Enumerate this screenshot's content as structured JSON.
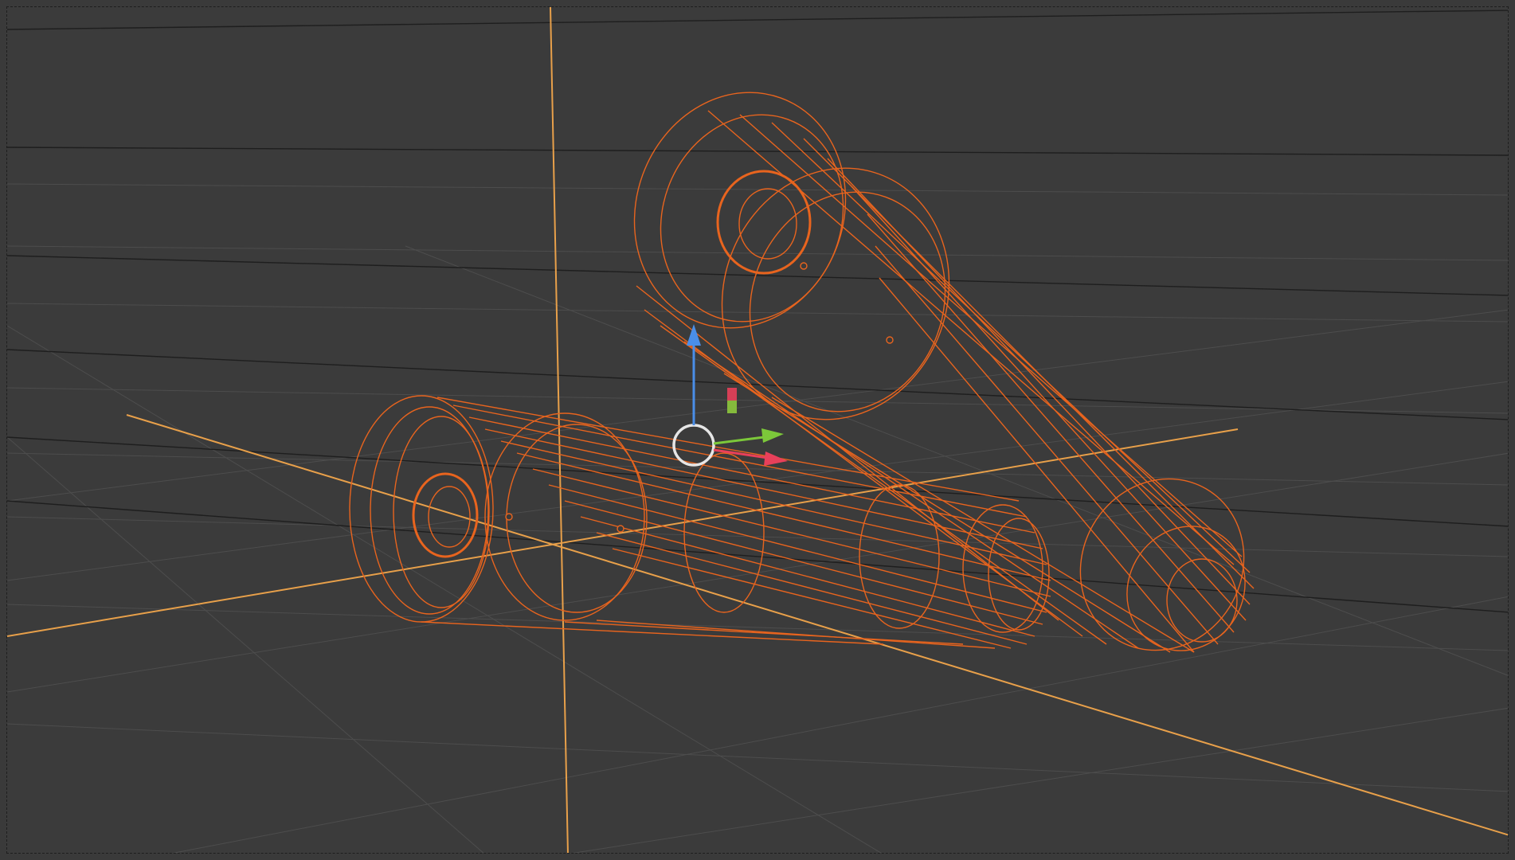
{
  "app": {
    "mode": "wireframe-3d-viewport"
  },
  "colors": {
    "background": "#3b3b3b",
    "grid_line": "#555555",
    "grid_major": "#1e1e1e",
    "axis_orange": "#e8a04a",
    "selection_orange": "#e8641e",
    "gizmo_z": "#4a8ee8",
    "gizmo_y": "#7cc83a",
    "gizmo_x": "#e8405a",
    "gizmo_ring": "#e6e6e6"
  },
  "scene": {
    "objects": [
      {
        "id": "tube-lower",
        "selected": true
      },
      {
        "id": "tube-upper",
        "selected": true
      }
    ],
    "gizmo": {
      "axes": [
        "x-axis-handle",
        "y-axis-handle",
        "z-axis-handle"
      ],
      "icons": [
        "transform-gizmo-icon",
        "cursor-ring-icon",
        "scale-handle-icon"
      ]
    }
  }
}
